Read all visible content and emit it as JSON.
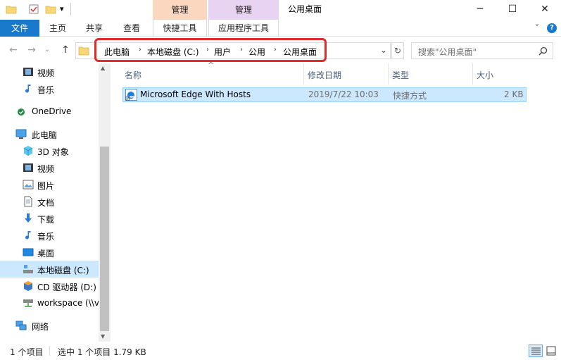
{
  "window": {
    "title": "公用桌面",
    "controls": {
      "minimize": "─",
      "maximize": "☐",
      "close": "✕"
    }
  },
  "qat": {
    "icons": [
      "folder-icon",
      "properties-icon",
      "new-folder-icon"
    ],
    "dropdown": "▾"
  },
  "context_tabs": [
    {
      "header": "管理",
      "sub": "快捷工具",
      "color": "#fbd7c0"
    },
    {
      "header": "管理",
      "sub": "应用程序工具",
      "color": "#e8d3f3"
    }
  ],
  "ribbon": {
    "file": "文件",
    "tabs": [
      "主页",
      "共享",
      "查看"
    ],
    "expand": "˅",
    "help": "?"
  },
  "address": {
    "crumbs": [
      "此电脑",
      "本地磁盘 (C:)",
      "用户",
      "公用",
      "公用桌面"
    ],
    "separator": "›",
    "dropdown": "⌄",
    "refresh": "↻"
  },
  "search": {
    "placeholder": "搜索\"公用桌面\"",
    "icon": "search-icon"
  },
  "nav_items": [
    {
      "label": "视频",
      "icon": "video-icon",
      "selected": false
    },
    {
      "label": "音乐",
      "icon": "music-icon",
      "selected": false
    },
    {
      "label": "OneDrive",
      "icon": "onedrive-icon",
      "selected": false
    },
    {
      "label": "此电脑",
      "icon": "this-pc-icon",
      "selected": false
    },
    {
      "label": "3D 对象",
      "icon": "3d-objects-icon",
      "selected": false
    },
    {
      "label": "视频",
      "icon": "video-icon",
      "selected": false
    },
    {
      "label": "图片",
      "icon": "pictures-icon",
      "selected": false
    },
    {
      "label": "文档",
      "icon": "documents-icon",
      "selected": false
    },
    {
      "label": "下载",
      "icon": "downloads-icon",
      "selected": false
    },
    {
      "label": "音乐",
      "icon": "music-icon",
      "selected": false
    },
    {
      "label": "桌面",
      "icon": "desktop-icon",
      "selected": false
    },
    {
      "label": "本地磁盘 (C:)",
      "icon": "drive-icon",
      "selected": true
    },
    {
      "label": "CD 驱动器 (D:) '",
      "icon": "cd-drive-icon",
      "selected": false
    },
    {
      "label": "workspace (\\\\v",
      "icon": "network-drive-icon",
      "selected": false
    },
    {
      "label": "网络",
      "icon": "network-icon",
      "selected": false
    }
  ],
  "columns": [
    "名称",
    "修改日期",
    "类型",
    "大小"
  ],
  "sort_indicator": "^",
  "files": [
    {
      "name": "Microsoft Edge With Hosts",
      "modified": "2019/7/22 10:03",
      "type": "快捷方式",
      "size": "2 KB",
      "icon": "edge-shortcut-icon",
      "selected": true
    }
  ],
  "status": {
    "count": "1 个项目",
    "selected": "选中 1 个项目  1.79 KB"
  },
  "colors": {
    "accent": "#1979ca",
    "selection": "#cce8ff",
    "highlight_box": "#e02b2b"
  }
}
